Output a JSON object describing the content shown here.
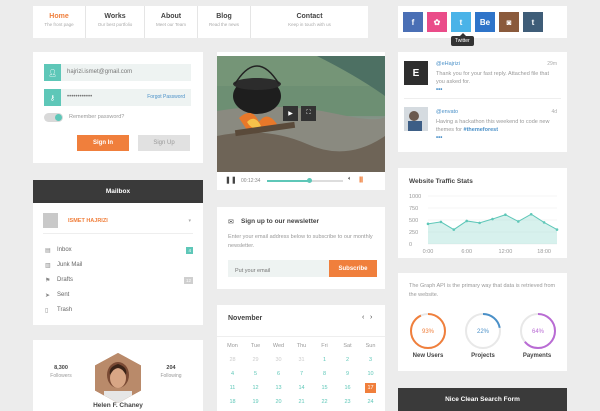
{
  "nav": [
    {
      "title": "Home",
      "sub": "The front page"
    },
    {
      "title": "Works",
      "sub": "Our best portfolio"
    },
    {
      "title": "About",
      "sub": "Meet our Team"
    },
    {
      "title": "Blog",
      "sub": "Read the news"
    },
    {
      "title": "Contact",
      "sub": "Keep in touch with us"
    }
  ],
  "social": {
    "buttons": [
      {
        "icon": "facebook-icon",
        "glyph": "f",
        "color": "#4a6fb5"
      },
      {
        "icon": "dribbble-icon",
        "glyph": "✿",
        "color": "#ea4c89"
      },
      {
        "icon": "twitter-icon",
        "glyph": "t",
        "color": "#4ab3e8"
      },
      {
        "icon": "behance-icon",
        "glyph": "Be",
        "color": "#2e74c9"
      },
      {
        "icon": "instagram-icon",
        "glyph": "◙",
        "color": "#8a5a3c"
      },
      {
        "icon": "tumblr-icon",
        "glyph": "t",
        "color": "#3f5d78"
      }
    ],
    "tooltip": "Twitter"
  },
  "login": {
    "email": "hajrizi.ismet@gmail.com",
    "password": "••••••••••••",
    "forgot": "Forgot Password",
    "remember": "Remember password?",
    "signin": "Sign In",
    "signup": "Sign Up"
  },
  "mailbox": {
    "title": "Mailbox",
    "user": "ISMET HAJRIZI",
    "items": [
      {
        "label": "Inbox",
        "icon": "inbox-icon",
        "glyph": "▤",
        "badge": "4",
        "badge_color": "#5ec7b8"
      },
      {
        "label": "Junk Mail",
        "icon": "junk-icon",
        "glyph": "▥",
        "badge": "",
        "badge_color": ""
      },
      {
        "label": "Drafts",
        "icon": "flag-icon",
        "glyph": "⚑",
        "badge": "12",
        "badge_color": "#cfcfcf"
      },
      {
        "label": "Sent",
        "icon": "sent-icon",
        "glyph": "➤",
        "badge": "",
        "badge_color": ""
      },
      {
        "label": "Trash",
        "icon": "trash-icon",
        "glyph": "▯",
        "badge": "",
        "badge_color": ""
      }
    ]
  },
  "profile": {
    "followers_count": "8,300",
    "followers_label": "Followers",
    "following_count": "204",
    "following_label": "Following",
    "name": "Helen F. Chaney"
  },
  "video": {
    "time": "00:12:34",
    "progress": 0.56
  },
  "newsletter": {
    "title": "Sign up to our newsletter",
    "text": "Enter your email address below to subscribe to our monthly newsletter.",
    "placeholder": "Put your email",
    "button": "Subscribe"
  },
  "calendar": {
    "month": "November",
    "days": [
      "Mon",
      "Tue",
      "Wed",
      "Thu",
      "Fri",
      "Sat",
      "Sun"
    ],
    "weeks": [
      [
        "28",
        "29",
        "30",
        "31",
        "1",
        "2",
        "3"
      ],
      [
        "4",
        "5",
        "6",
        "7",
        "8",
        "9",
        "10"
      ],
      [
        "11",
        "12",
        "13",
        "14",
        "15",
        "16",
        "17"
      ],
      [
        "18",
        "19",
        "20",
        "21",
        "22",
        "23",
        "24"
      ]
    ],
    "today": "17"
  },
  "tweets": [
    {
      "user": "@eHajrizi",
      "time": "29m",
      "text": "Thank you for your fast reply. Attached file that you asked for.",
      "avatar_glyph": "E"
    },
    {
      "user": "@envato",
      "time": "4d",
      "text": "Having a hackathon this weekend to code new themes for ",
      "tag": "#themeforest"
    }
  ],
  "traffic": {
    "title": "Website Traffic Stats"
  },
  "chart_data": {
    "type": "area",
    "x": [
      "0:00",
      "2:00",
      "4:00",
      "6:00",
      "8:00",
      "10:00",
      "12:00",
      "14:00",
      "16:00",
      "18:00",
      "20:00"
    ],
    "values": [
      420,
      460,
      300,
      480,
      440,
      520,
      610,
      470,
      620,
      450,
      300
    ],
    "ylim": [
      0,
      1000
    ],
    "yticks": [
      "1000",
      "750",
      "500",
      "250",
      "0"
    ],
    "xticks": [
      "0:00",
      "6:00",
      "12:00",
      "18:00"
    ],
    "color": "#5ec7b8"
  },
  "progress": {
    "text": "The Graph API is the primary way that data is retrieved from the website.",
    "rings": [
      {
        "label": "New Users",
        "value": 93,
        "text": "93%",
        "color": "#f07f3c"
      },
      {
        "label": "Projects",
        "value": 22,
        "text": "22%",
        "color": "#4a90c8"
      },
      {
        "label": "Payments",
        "value": 64,
        "text": "64%",
        "color": "#b96bd4"
      }
    ]
  },
  "search": {
    "title": "Nice Clean Search Form"
  }
}
